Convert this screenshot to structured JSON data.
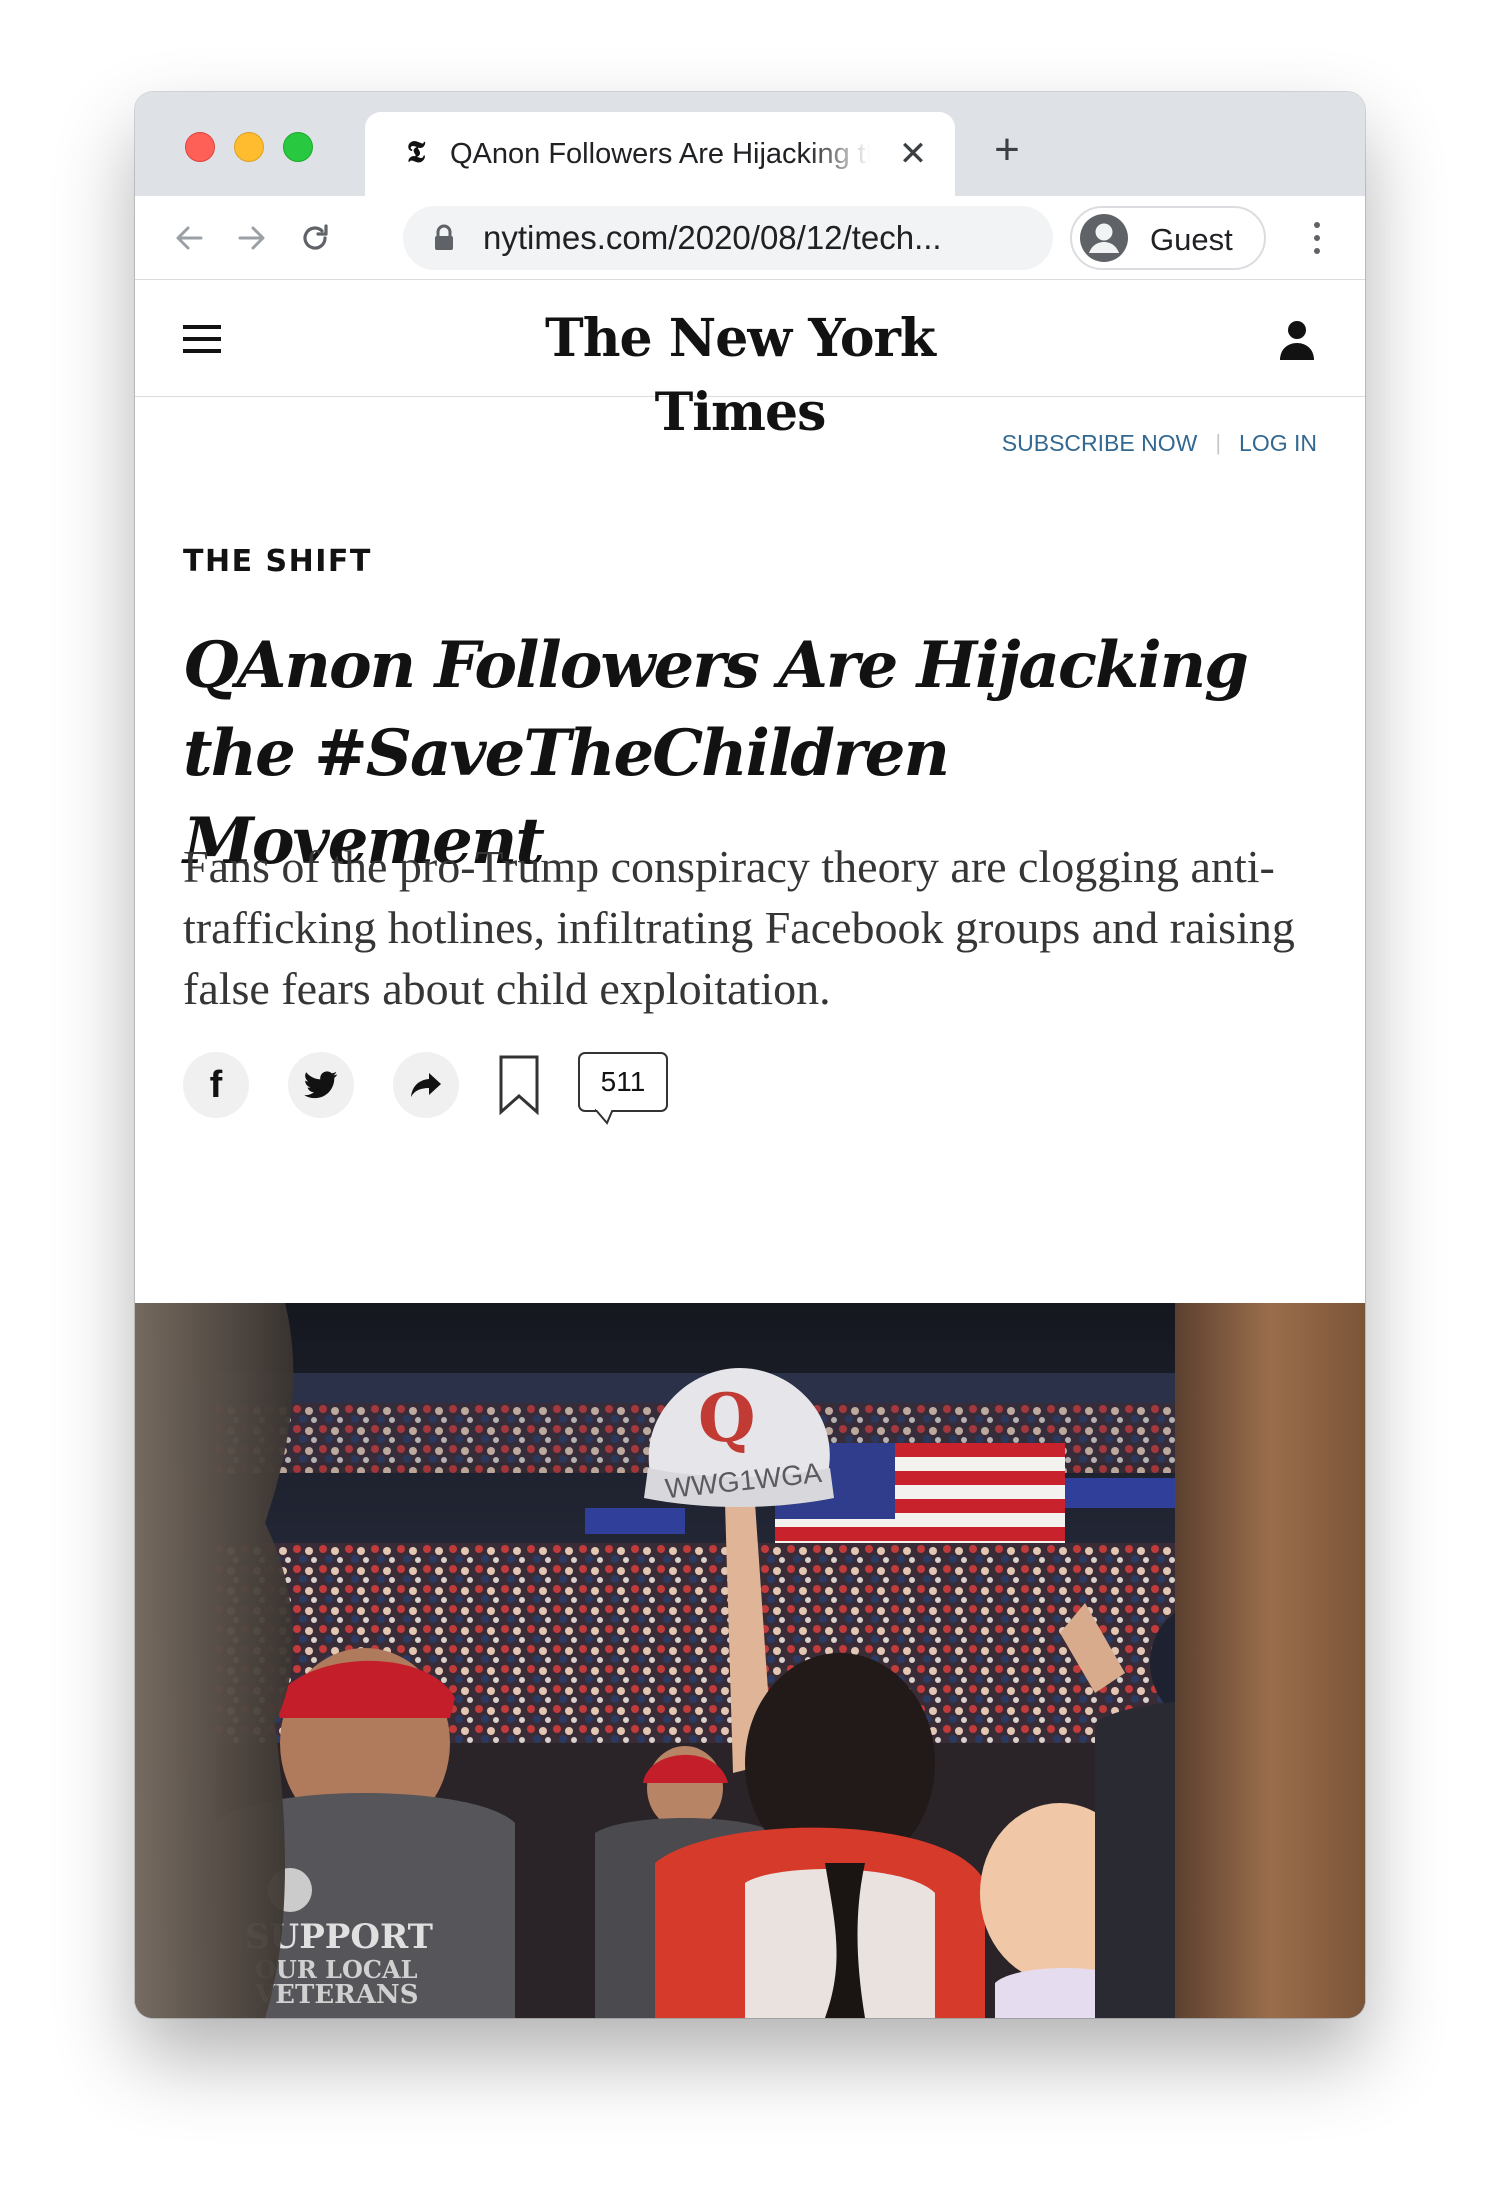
{
  "browser": {
    "tab": {
      "favicon_glyph": "𝕿",
      "title": "QAnon Followers Are Hijacking the #SaveTheChildren Movement",
      "close_glyph": "✕"
    },
    "new_tab_glyph": "+",
    "nav": {
      "back_icon": "arrow-left-icon",
      "forward_icon": "arrow-right-icon",
      "reload_icon": "reload-icon"
    },
    "url": "nytimes.com/2020/08/12/tech...",
    "profile_label": "Guest"
  },
  "site": {
    "masthead": "The New York Times",
    "subscribe_label": "SUBSCRIBE NOW",
    "login_label": "LOG IN",
    "separator": "|"
  },
  "article": {
    "kicker": "THE SHIFT",
    "headline": "QAnon Followers Are Hijacking the #SaveTheChildren Movement",
    "summary": "Fans of the pro-Trump conspiracy theory are clogging anti-trafficking hotlines, infiltrating Facebook groups and raising false fears about child exploitation.",
    "share": {
      "facebook_glyph": "f",
      "comment_count": "511"
    },
    "photo": {
      "hat_text": "WWG1WGA",
      "hat_letter": "Q",
      "shirt_text": "SUPPORT",
      "shirt_text_2": "OUR LOCAL",
      "shirt_text_3": "VETERANS"
    }
  },
  "colors": {
    "link_blue": "#326891",
    "headline": "#121212",
    "tabstrip": "#dee1e6"
  }
}
